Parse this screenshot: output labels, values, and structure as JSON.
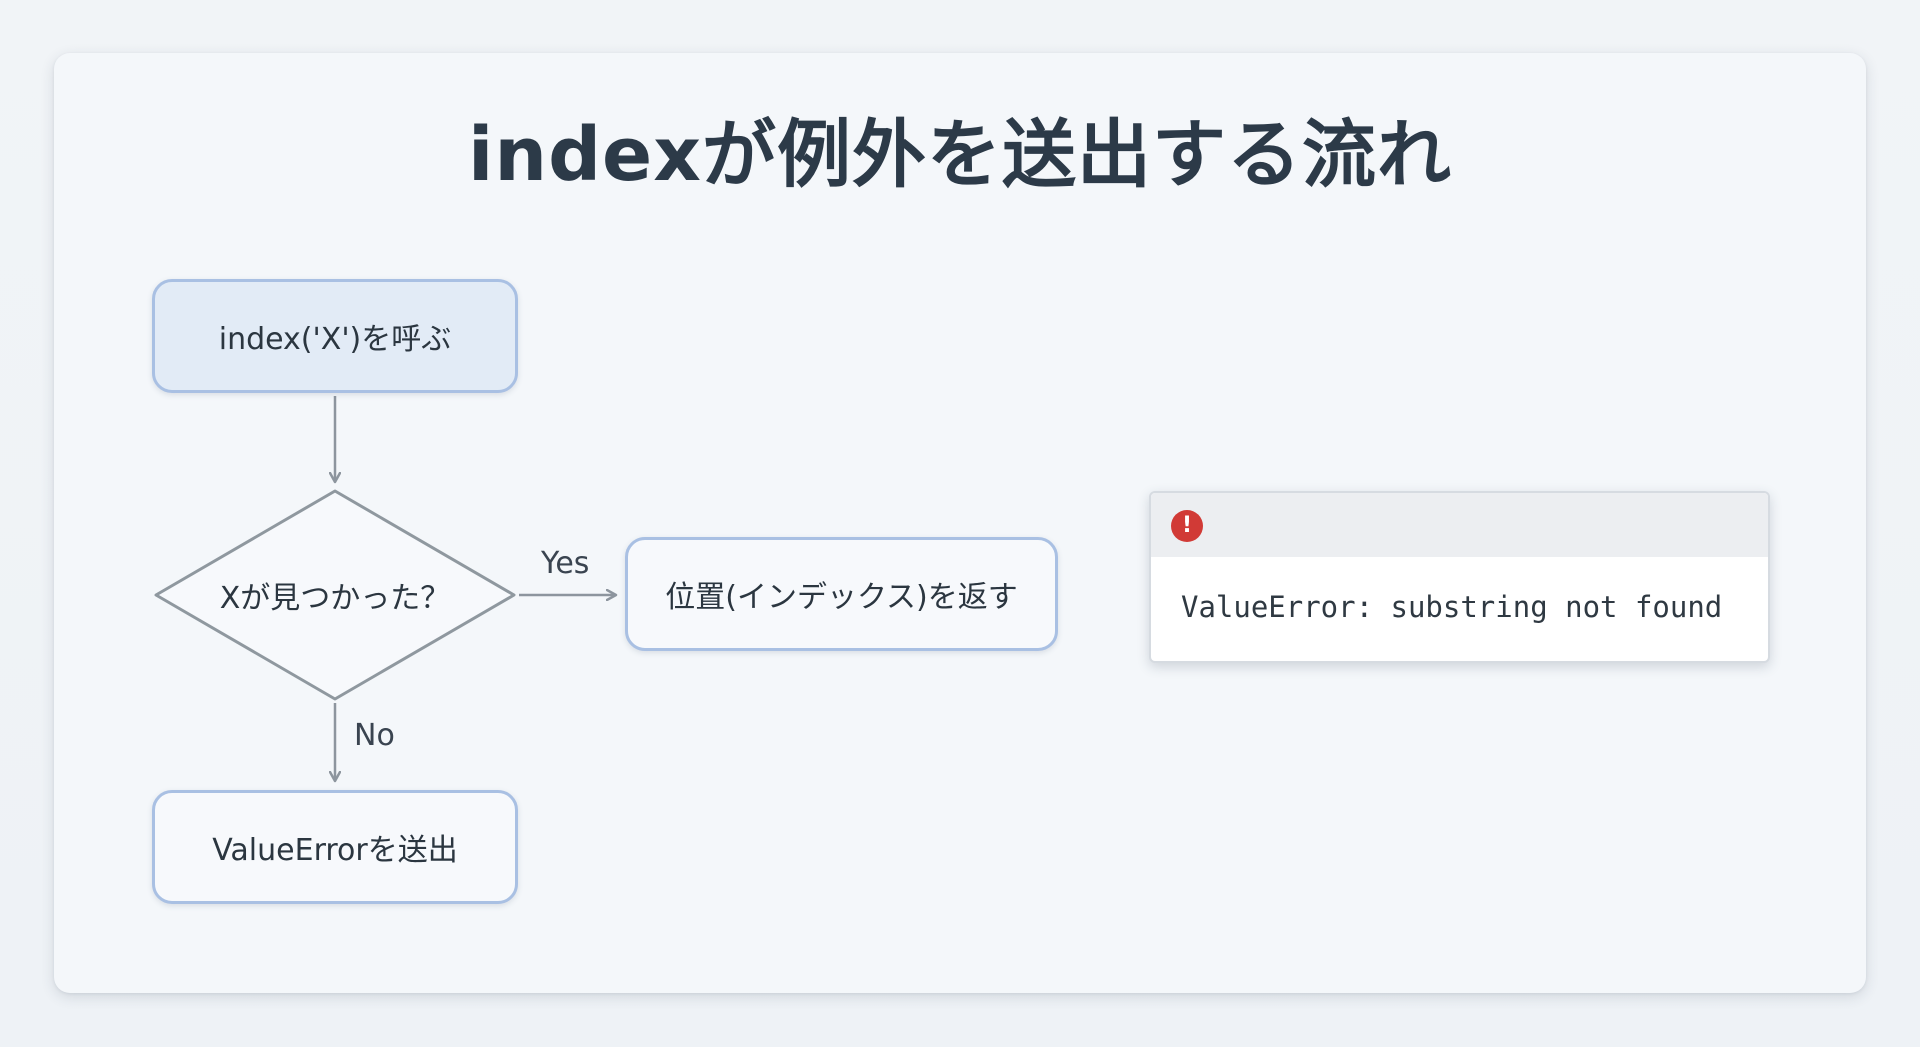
{
  "title": "indexが例外を送出する流れ",
  "flow": {
    "start": "index('X')を呼ぶ",
    "decision": "Xが見つかった？",
    "yes_label": "Yes",
    "no_label": "No",
    "yes_result": "位置(インデックス)を返す",
    "no_result": "ValueErrorを送出"
  },
  "error_panel": {
    "icon": "error-exclamation-icon",
    "icon_glyph": "!",
    "icon_color": "#d13a36",
    "message": "ValueError: substring not found"
  }
}
